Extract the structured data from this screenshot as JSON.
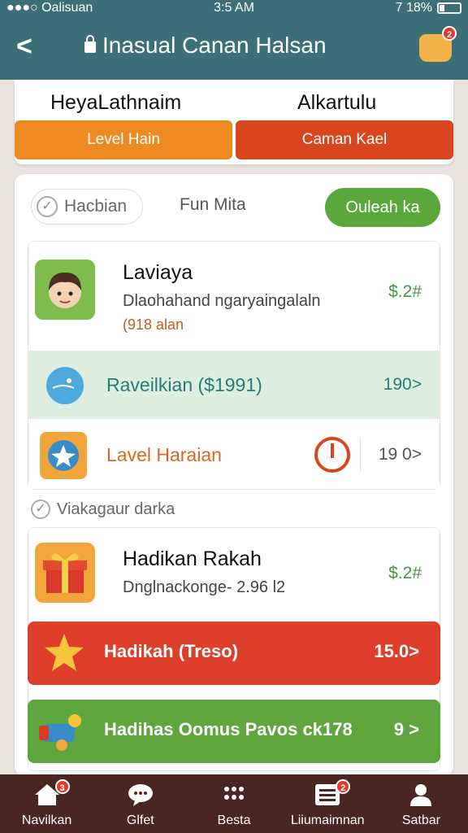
{
  "status": {
    "carrier": "●●●○ Oalisuan",
    "time": "3:5 AM",
    "battery": "7 18%"
  },
  "header": {
    "back_label": "<",
    "title": "Inasual Canan Halsan",
    "notification_count": "2"
  },
  "top_card": {
    "heading_left": "HeyaLathnaim",
    "heading_right": "Alkartulu",
    "tab_left": "Level Hain",
    "tab_right": "Caman Kael",
    "colors": {
      "tab_left": "#ef8a23",
      "tab_right": "#d9461e"
    }
  },
  "filters": {
    "chip": "Hacbian",
    "label": "Fun Mita",
    "action": "Ouleah ka"
  },
  "item1": {
    "title": "Laviaya",
    "subtitle": "Dlaohahand ngaryaingalaln",
    "meta": "(918 alan",
    "price": "$.2#"
  },
  "row1": {
    "label": "Raveilkian ($1991)",
    "value": "190>"
  },
  "row2": {
    "label": "Lavel Haraian",
    "value": "19 0>"
  },
  "section_label": "Viakagaur darka",
  "item2": {
    "title": "Hadikan Rakah",
    "subtitle": "Dnglnackonge- 2.96 l2",
    "price": "$.2#"
  },
  "banner_red": {
    "label": "Hadikah (Treso)",
    "value": "15.0>",
    "color": "#dd3f2a"
  },
  "banner_green": {
    "label": "Hadihas Oomus Pavos ck178",
    "value": "9 >",
    "color": "#5ea63d"
  },
  "nav": {
    "items": [
      {
        "label": "Navilkan",
        "icon": "home-icon",
        "badge": "3"
      },
      {
        "label": "Glfet",
        "icon": "chat-icon",
        "badge": ""
      },
      {
        "label": "Besta",
        "icon": "grid-icon",
        "badge": ""
      },
      {
        "label": "Liiumaimnan",
        "icon": "list-icon",
        "badge": "2"
      },
      {
        "label": "Satbar",
        "icon": "profile-icon",
        "badge": ""
      }
    ]
  }
}
